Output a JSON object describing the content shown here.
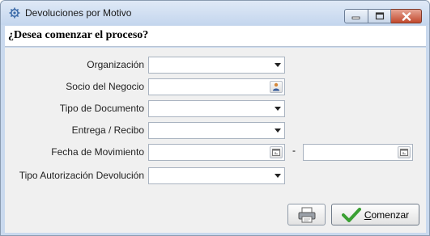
{
  "window": {
    "title": "Devoluciones por Motivo",
    "title_icon": "gear-icon"
  },
  "header": {
    "question": "¿Desea comenzar el proceso?"
  },
  "form": {
    "organizacion_label": "Organización",
    "socio_label": "Socio del Negocio",
    "tipo_documento_label": "Tipo de Documento",
    "entrega_label": "Entrega / Recibo",
    "fecha_label": "Fecha de Movimiento",
    "fecha_separator": "-",
    "tipo_autorizacion_label": "Tipo Autorización Devolución"
  },
  "buttons": {
    "print_icon": "printer-icon",
    "start_first_letter": "C",
    "start_rest": "omenzar",
    "start_icon": "checkmark-icon"
  },
  "colors": {
    "titlebar": "#c4d6ee",
    "close_button": "#c2492d",
    "checkmark": "#3aa033"
  }
}
